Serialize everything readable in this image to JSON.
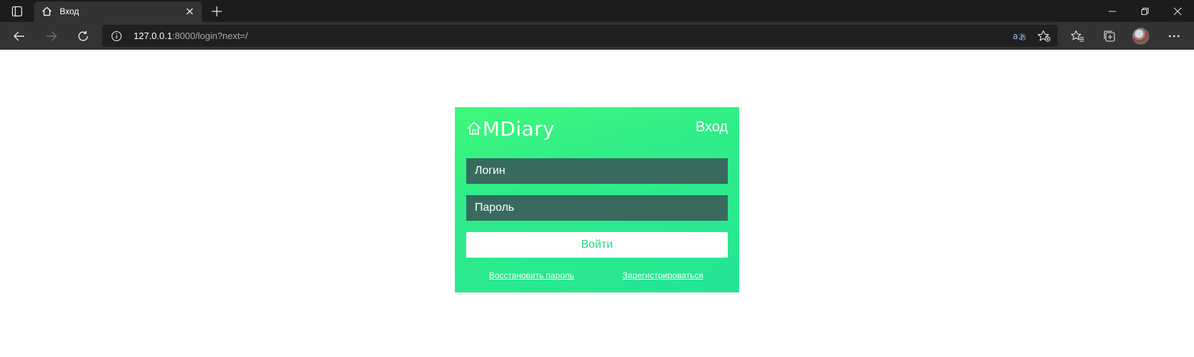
{
  "browser": {
    "tab": {
      "title": "Вход",
      "icon": "home-icon"
    },
    "address": {
      "host": "127.0.0.1",
      "rest": ":8000/login?next=/"
    }
  },
  "login_card": {
    "brand": "MDiary",
    "title": "Вход",
    "login_placeholder": "Логин",
    "password_placeholder": "Пароль",
    "submit_label": "Войти",
    "restore_link": "Восстановить пароль",
    "register_link": "Зарегистрироваться"
  },
  "colors": {
    "card_gradient_start": "#3ff97a",
    "card_gradient_end": "#25e494",
    "input_bg": "#366b5e",
    "button_text": "#27d98a"
  }
}
